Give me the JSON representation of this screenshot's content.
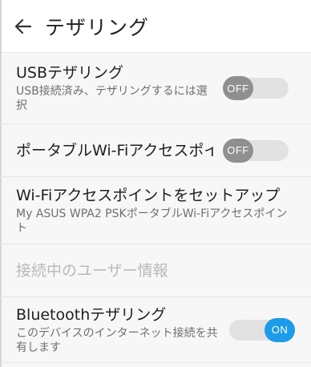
{
  "appbar": {
    "title": "テザリング",
    "back_icon": "arrow-left-icon"
  },
  "items": [
    {
      "title": "USBテザリング",
      "summary": "USB接続済み、テザリングするには選択",
      "toggle": "OFF"
    },
    {
      "title": "ポータブルWi-Fiアクセスポイ..",
      "toggle": "OFF"
    },
    {
      "title": "Wi-Fiアクセスポイントをセットアップ",
      "summary": "My ASUS WPA2 PSKポータブルWi-Fiアクセスポイント"
    },
    {
      "title": "接続中のユーザー情報"
    },
    {
      "title": "Bluetoothテザリング",
      "summary": "このデバイスのインターネット接続を共有します",
      "toggle": "ON"
    }
  ],
  "colors": {
    "toggle_on": "#1e9be8",
    "toggle_off": "#8f8f8f",
    "track": "#e2e2e2",
    "background": "#f7f7f7"
  }
}
